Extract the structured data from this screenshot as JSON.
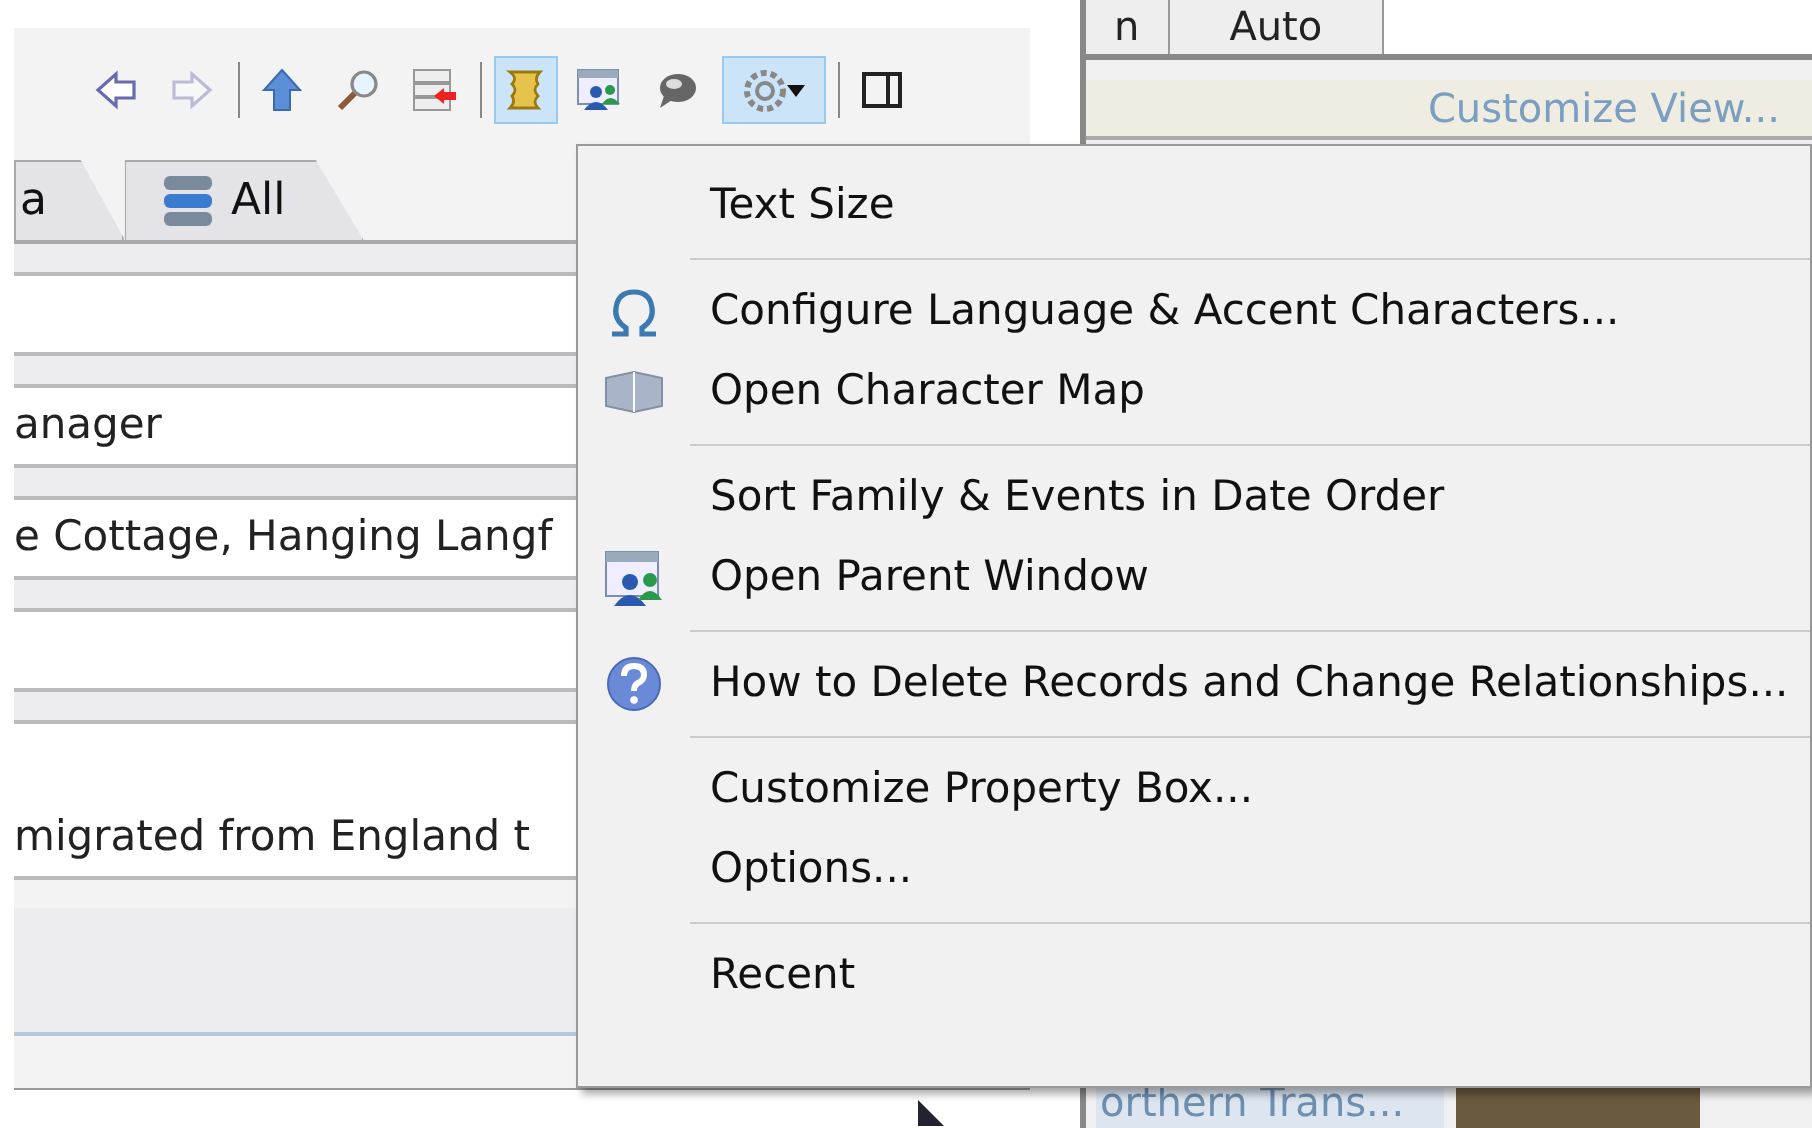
{
  "header_cells": [
    "n",
    "Auto"
  ],
  "customize_link": "Customize View...",
  "toolbar": [
    {
      "kind": "back",
      "pressed": false,
      "disabled": false
    },
    {
      "kind": "forward",
      "pressed": false,
      "disabled": true
    },
    {
      "kind": "sep"
    },
    {
      "kind": "up",
      "pressed": false,
      "disabled": false
    },
    {
      "kind": "search",
      "pressed": false,
      "disabled": false
    },
    {
      "kind": "remove",
      "pressed": false,
      "disabled": false
    },
    {
      "kind": "sep"
    },
    {
      "kind": "scroll",
      "pressed": true,
      "disabled": false
    },
    {
      "kind": "parent",
      "pressed": false,
      "disabled": false
    },
    {
      "kind": "speech",
      "pressed": false,
      "disabled": false
    },
    {
      "kind": "gear",
      "pressed": true,
      "disabled": false
    },
    {
      "kind": "sep"
    },
    {
      "kind": "panel",
      "pressed": false,
      "disabled": false
    }
  ],
  "tabs": [
    {
      "label": "a",
      "selected": false
    },
    {
      "label": "All",
      "selected": false
    }
  ],
  "fields": [
    {
      "kind": "line"
    },
    {
      "kind": "line",
      "value": "anager"
    },
    {
      "kind": "line",
      "value": "e Cottage, Hanging Langf"
    },
    {
      "kind": "line"
    },
    {
      "kind": "note",
      "value": "migrated from England t"
    }
  ],
  "list_cell": "orthern Trans...",
  "menu": [
    [
      {
        "label": "Text Size",
        "kind": "plain"
      }
    ],
    [
      {
        "label": "Configure Language & Accent Characters...",
        "kind": "omega"
      },
      {
        "label": "Open Character Map",
        "kind": "charmap"
      }
    ],
    [
      {
        "label": "Sort Family & Events in Date Order",
        "kind": "plain"
      },
      {
        "label": "Open Parent Window",
        "kind": "parent"
      }
    ],
    [
      {
        "label": "How to Delete Records and Change Relationships...",
        "kind": "help"
      }
    ],
    [
      {
        "label": "Customize Property Box...",
        "kind": "plain"
      },
      {
        "label": "Options...",
        "kind": "plain"
      }
    ],
    [
      {
        "label": "Recent",
        "kind": "plain"
      }
    ]
  ]
}
